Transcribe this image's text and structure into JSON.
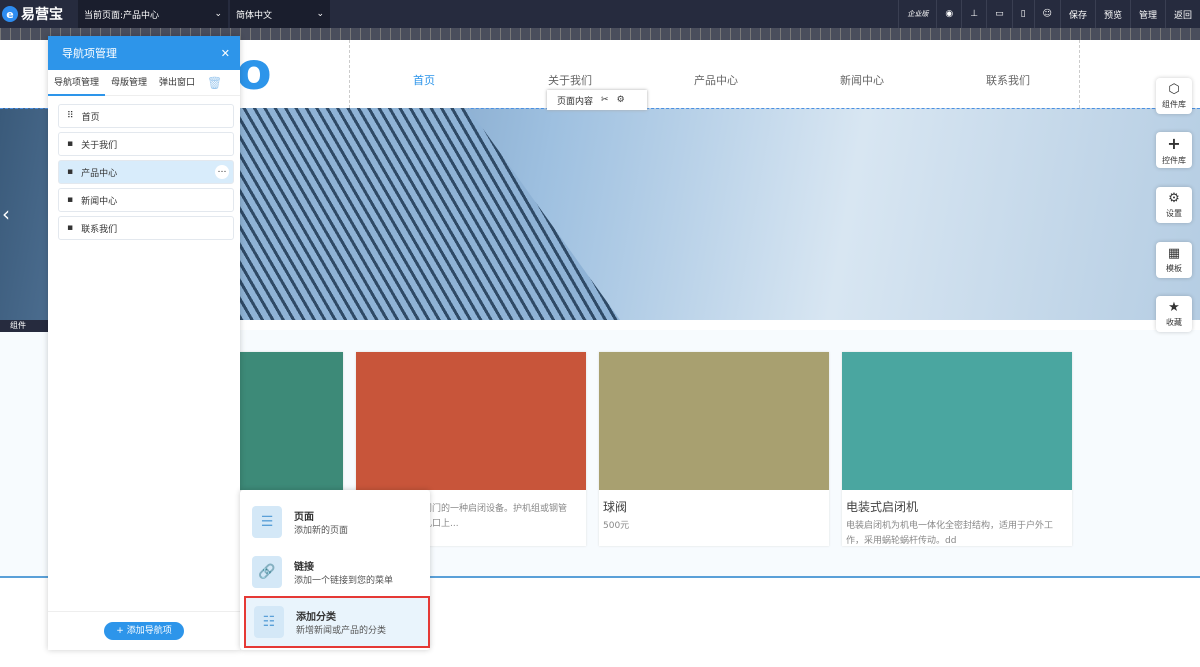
{
  "topbar": {
    "brand": "易营宝",
    "page_select": "当前页面:产品中心",
    "lang_select": "简体中文",
    "buttons": [
      "企业版",
      "保存",
      "预览",
      "管理",
      "返回"
    ]
  },
  "site": {
    "logo_fragment": "o",
    "nav": [
      "首页",
      "关于我们",
      "产品中心",
      "新闻中心",
      "联系我们"
    ],
    "page_content_label": "页面内容"
  },
  "panel": {
    "title": "导航项管理",
    "tabs": [
      "导航项管理",
      "母版管理",
      "弹出窗口"
    ],
    "items": [
      "首页",
      "关于我们",
      "产品中心",
      "新闻中心",
      "联系我们"
    ],
    "add_label": "+ 添加导航项",
    "component_label": "组件"
  },
  "products": [
    {
      "title": "",
      "desc": ""
    },
    {
      "title": "",
      "desc": "门用于操作快速闸门的一种启闭设备。护机组或钢管的，平时悬挂在孔口上..."
    },
    {
      "title": "球阀",
      "desc": "500元"
    },
    {
      "title": "电装式启闭机",
      "desc": "电装启闭机为机电一体化全密封结构，适用于户外工作，采用蜗轮蜗杆传动。dd"
    }
  ],
  "right_tools": [
    "组件库",
    "控件库",
    "设置",
    "模板",
    "收藏"
  ],
  "add_menu": [
    {
      "title": "页面",
      "desc": "添加新的页面"
    },
    {
      "title": "链接",
      "desc": "添加一个链接到您的菜单"
    },
    {
      "title": "添加分类",
      "desc": "新增新闻或产品的分类"
    }
  ]
}
